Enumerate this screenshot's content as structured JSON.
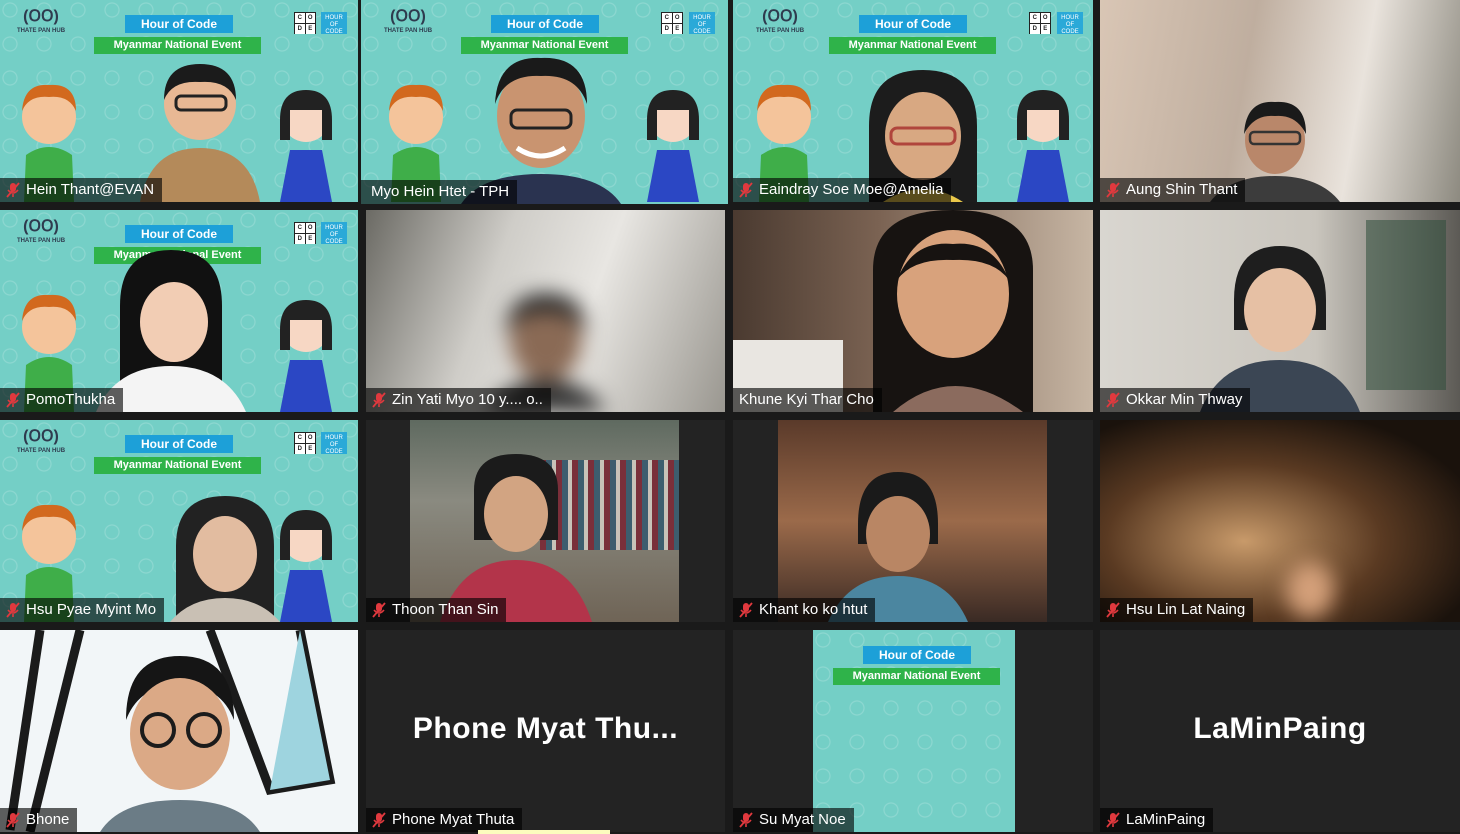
{
  "event": {
    "badge": "Hour of Code",
    "subtitle": "Myanmar National Event",
    "logo_text": "THATE PAN HUB",
    "logo_glyph": "(ᱛᱛ)",
    "code_letters": [
      "C",
      "O",
      "D",
      "E"
    ],
    "hoc_badge": "HOUR OF CODE"
  },
  "participants": [
    {
      "name": "Hein Thant@EVAN",
      "muted": true
    },
    {
      "name": "Myo Hein Htet - TPH",
      "muted": false,
      "active": true
    },
    {
      "name": "Eaindray Soe Moe@Amelia",
      "muted": true
    },
    {
      "name": "Aung Shin Thant",
      "muted": true
    },
    {
      "name": "PomoThukha",
      "muted": true
    },
    {
      "name": "Zin Yati Myo 10 y.... o..",
      "muted": true
    },
    {
      "name": "Khune Kyi Thar Cho",
      "muted": false
    },
    {
      "name": "Okkar Min Thway",
      "muted": true
    },
    {
      "name": "Hsu Pyae Myint Mo",
      "muted": true
    },
    {
      "name": "Thoon Than Sin",
      "muted": true
    },
    {
      "name": "Khant ko ko htut",
      "muted": true
    },
    {
      "name": "Hsu Lin Lat Naing",
      "muted": true
    },
    {
      "name": "Bhone",
      "muted": true
    },
    {
      "name": "Phone Myat Thuta",
      "muted": true,
      "big": "Phone  Myat  Thu..."
    },
    {
      "name": "Su Myat Noe",
      "muted": true
    },
    {
      "name": "LaMinPaing",
      "muted": true,
      "big": "LaMinPaing"
    }
  ],
  "colors": {
    "active_border": "#e6ee6a",
    "event_bg": "#74cfc6",
    "muted_icon": "#e0393e"
  }
}
